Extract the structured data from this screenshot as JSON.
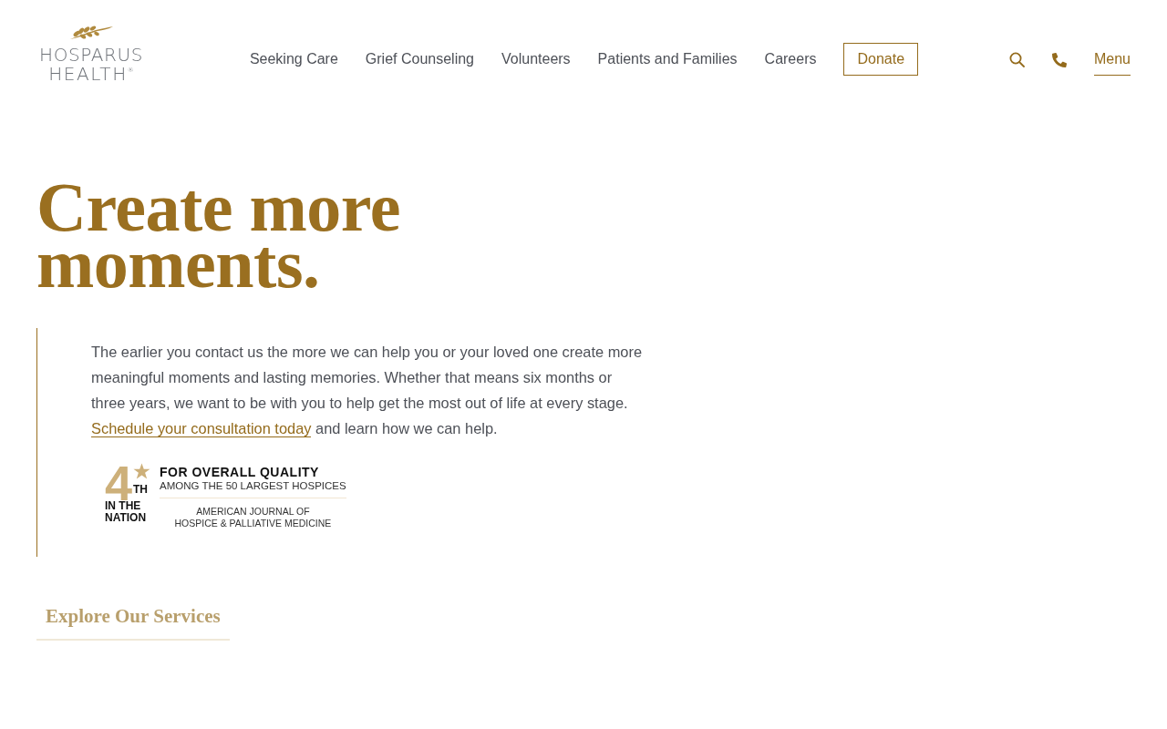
{
  "header": {
    "logo": {
      "line_1": "HOSPARUS",
      "line_2": "HEALTH$^{®}$"
    },
    "nav": [
      {
        "label": "Seeking Care",
        "kind": "link"
      },
      {
        "label": "Grief Counseling",
        "kind": "link"
      },
      {
        "label": "Volunteers",
        "kind": "link"
      },
      {
        "label": "Patients and Families",
        "kind": "link"
      },
      {
        "label": "Careers",
        "kind": "link"
      },
      {
        "label": "Donate",
        "kind": "button"
      }
    ],
    "menu_label": "Menu"
  },
  "hero": {
    "title": "Create more moments.",
    "paragraph": "The earlier you contact us the more we can help you or your loved one create more meaningful moments and lasting memories. Whether that means six months or three years, we want to be with you to help get the most out of life at every stage.",
    "link": "Schedule your consultation today",
    "after_link": "and learn how we can help.",
    "award": {
      "rank": "4",
      "rank_suffix": "TH",
      "rank_caption": "IN THE NATION",
      "headline": "FOR OVERALL QUALITY",
      "subline": "AMONG THE 50 LARGEST HOSPICES",
      "source_lines": [
        "AMERICAN JOURNAL OF",
        "HOSPICE & PALLIATIVE MEDICINE"
      ]
    },
    "services_button": "Explore Our Services"
  }
}
